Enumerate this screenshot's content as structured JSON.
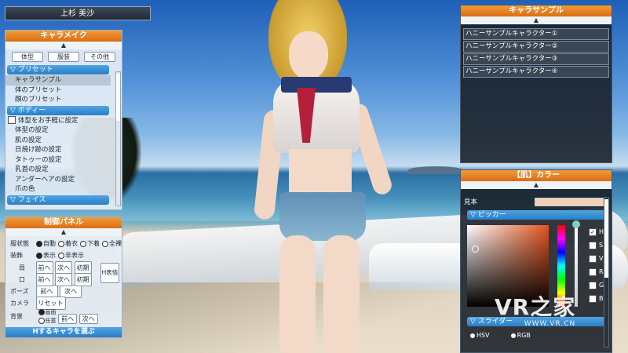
{
  "character_name": "上杉 美沙",
  "chara_make": {
    "title": "キャラメイク",
    "tabs": [
      "体型",
      "服装",
      "その他"
    ],
    "sections": [
      {
        "label": "▽ プリセット",
        "items": [
          "キャラサンプル",
          "体のプリセット",
          "顔のプリセット"
        ]
      },
      {
        "label": "▽ ボディー",
        "items": [
          "体型をお手軽に設定",
          "体型の設定",
          "肌の設定",
          "日焼け跡の設定",
          "タトゥーの設定",
          "乳首の設定",
          "アンダーヘアの設定",
          "爪の色"
        ]
      },
      {
        "label": "▽ フェイス",
        "items": []
      }
    ],
    "selected": "キャラサンプル"
  },
  "control_panel": {
    "title": "制御パネル",
    "rows": {
      "clothing_state": {
        "label": "服状態",
        "options": [
          "自動",
          "着衣",
          "下着",
          "全裸"
        ]
      },
      "accessory": {
        "label": "装飾",
        "options": [
          "表示",
          "非表示"
        ]
      },
      "eyes": {
        "label": "目",
        "buttons": [
          "前へ",
          "次へ",
          "初期"
        ]
      },
      "mouth": {
        "label": "口",
        "buttons": [
          "前へ",
          "次へ",
          "初期"
        ]
      },
      "h_expression": "H表情",
      "pose": {
        "label": "ポーズ",
        "buttons": [
          "前へ",
          "次へ"
        ]
      },
      "camera": {
        "label": "カメラ",
        "button": "リセット"
      },
      "background": {
        "label": "背景",
        "options": [
          "画面",
          "任意"
        ],
        "buttons": [
          "前へ",
          "次へ"
        ]
      }
    },
    "select_h_chara": "Hするキャラを選ぶ"
  },
  "chara_sample": {
    "title": "キャラサンプル",
    "items": [
      "ハニーサンプルキャラクター①",
      "ハニーサンプルキャラクター②",
      "ハニーサンプルキャラクター③",
      "ハニーサンプルキャラクター④"
    ]
  },
  "color_panel": {
    "title": "【肌】カラー",
    "sample_label": "見本",
    "picker_label": "▽ ピッカー",
    "channels": [
      "H",
      "S",
      "V",
      "R",
      "G",
      "B",
      "A"
    ],
    "checked_channel": "H",
    "slider_label": "▽ スライダー",
    "modes": [
      "HSV",
      "RGB"
    ]
  },
  "watermark": {
    "logo": "VR之家",
    "url": "WWW.VR.CN"
  },
  "colors": {
    "accent_orange": "#e8821f",
    "section_blue": "#3a90d4",
    "panel_bg": "#e6eef6"
  }
}
